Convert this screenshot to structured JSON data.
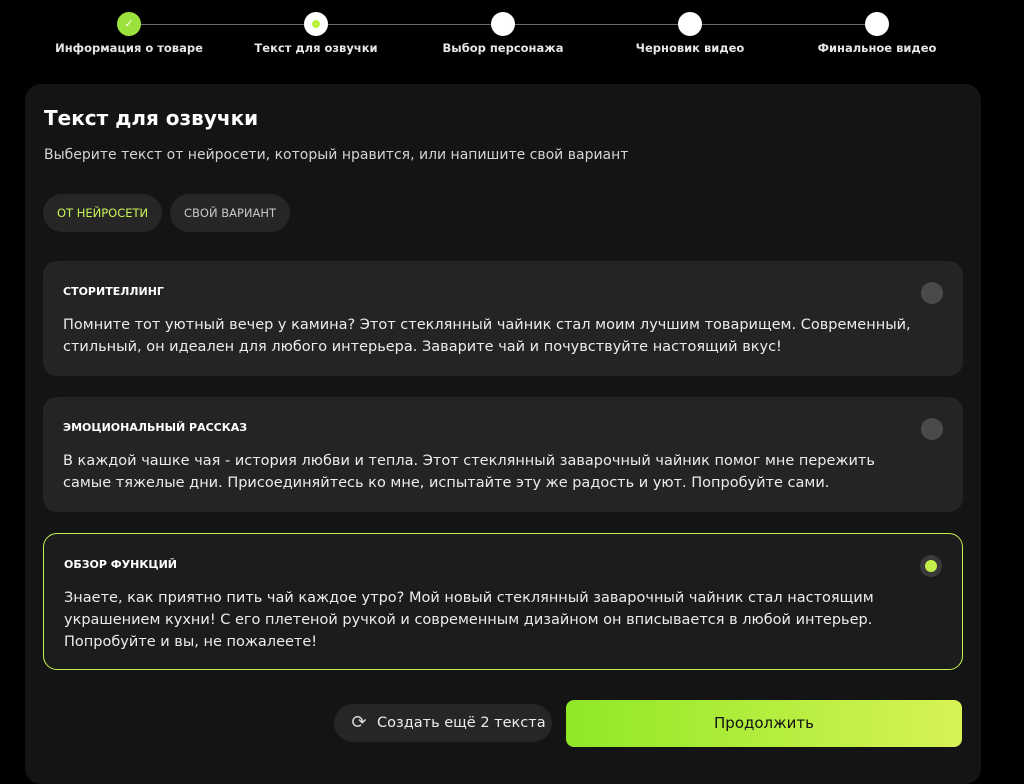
{
  "stepper": {
    "steps": [
      {
        "label": "Информация о товаре",
        "state": "done"
      },
      {
        "label": "Текст для озвучки",
        "state": "active"
      },
      {
        "label": "Выбор персонажа",
        "state": "pending"
      },
      {
        "label": "Черновик видео",
        "state": "pending"
      },
      {
        "label": "Финальное видео",
        "state": "pending"
      }
    ]
  },
  "panel": {
    "title": "Текст для озвучки",
    "subtitle": "Выберите текст от нейросети, который нравится, или напишите свой вариант"
  },
  "tabs": [
    {
      "label": "ОТ НЕЙРОСЕТИ",
      "selected": true
    },
    {
      "label": "СВОЙ ВАРИАНТ",
      "selected": false
    }
  ],
  "options": [
    {
      "title": "СТОРИТЕЛЛИНГ",
      "text": "Помните тот уютный вечер у камина? Этот стеклянный чайник стал моим лучшим товарищем. Современный, стильный, он идеален для любого интерьера. Заварите чай и почувствуйте настоящий вкус!",
      "selected": false
    },
    {
      "title": "ЭМОЦИОНАЛЬНЫЙ РАССКАЗ",
      "text": "В каждой чашке чая - история любви и тепла. Этот стеклянный заварочный чайник помог мне пережить самые тяжелые дни. Присоединяйтесь ко мне, испытайте эту же радость и уют. Попробуйте сами.",
      "selected": false
    },
    {
      "title": "ОБЗОР ФУНКЦИЙ",
      "text": "Знаете, как приятно пить чай каждое утро? Мой новый стеклянный заварочный чайник стал настоящим украшением кухни! С его плетеной ручкой и современным дизайном он вписывается в любой интерьер. Попробуйте и вы, не пожалеете!",
      "selected": true
    }
  ],
  "actions": {
    "regenerate_label": "Создать ещё 2 текста",
    "regenerate_icon": "refresh-icon",
    "continue_label": "Продолжить"
  },
  "colors": {
    "accent": "#c2f24a",
    "done_step": "#9be23c",
    "card_bg": "#141414",
    "option_bg": "#242424"
  }
}
